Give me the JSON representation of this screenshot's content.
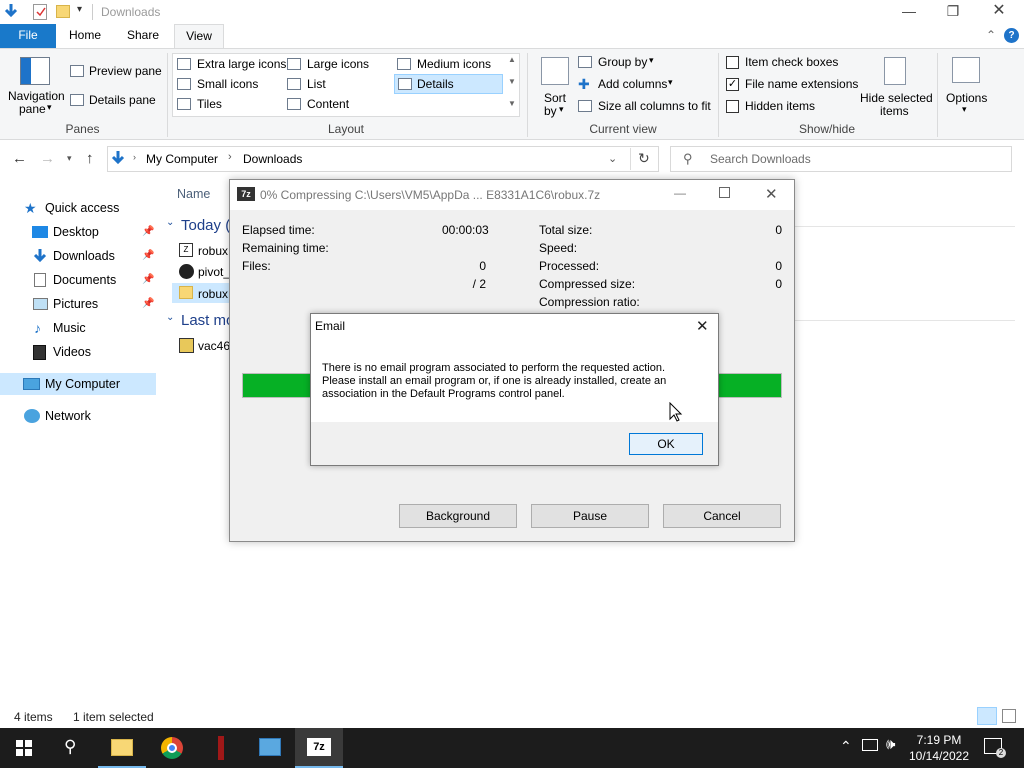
{
  "window": {
    "title": "Downloads"
  },
  "tabs": {
    "file": "File",
    "home": "Home",
    "share": "Share",
    "view": "View"
  },
  "ribbon": {
    "panes": {
      "navigation_pane": "Navigation",
      "navigation_pane2": "pane",
      "preview_pane": "Preview pane",
      "details_pane": "Details pane",
      "group": "Panes"
    },
    "layout": {
      "extra_large": "Extra large icons",
      "large": "Large icons",
      "medium": "Medium icons",
      "small": "Small icons",
      "list": "List",
      "details": "Details",
      "tiles": "Tiles",
      "content": "Content",
      "group": "Layout"
    },
    "current_view": {
      "sort_by": "Sort",
      "sort_by2": "by",
      "group_by": "Group by",
      "add_columns": "Add columns",
      "size_columns": "Size all columns to fit",
      "group": "Current view"
    },
    "show_hide": {
      "item_check_boxes": "Item check boxes",
      "file_name_extensions": "File name extensions",
      "hidden_items": "Hidden items",
      "hide_selected": "Hide selected",
      "hide_selected2": "items",
      "options": "Options",
      "group": "Show/hide"
    }
  },
  "address": {
    "root": "My Computer",
    "folder": "Downloads",
    "search_placeholder": "Search Downloads"
  },
  "nav": {
    "quick_access": "Quick access",
    "desktop": "Desktop",
    "downloads": "Downloads",
    "documents": "Documents",
    "pictures": "Pictures",
    "music": "Music",
    "videos": "Videos",
    "my_computer": "My Computer",
    "network": "Network"
  },
  "files": {
    "name_col": "Name",
    "today": "Today (",
    "f1": "robux",
    "f2": "pivot_",
    "f3": "robux",
    "last_mod": "Last mo",
    "f4": "vac46"
  },
  "status": {
    "items": "4 items",
    "selected": "1 item selected"
  },
  "zip": {
    "title": "0% Compressing C:\\Users\\VM5\\AppDa ... E8331A1C6\\robux.7z",
    "elapsed_label": "Elapsed time:",
    "elapsed": "00:00:03",
    "remaining_label": "Remaining time:",
    "files_label": "Files:",
    "files": "0",
    "files_total": "/ 2",
    "total_size_label": "Total size:",
    "total_size": "0",
    "speed_label": "Speed:",
    "processed_label": "Processed:",
    "processed": "0",
    "compressed_label": "Compressed size:",
    "compressed": "0",
    "ratio_label": "Compression ratio:",
    "progress": 1.0,
    "background": "Background",
    "pause": "Pause",
    "cancel": "Cancel"
  },
  "email": {
    "title": "Email",
    "line1": "There is no email program associated to perform the requested action.",
    "line2": "Please install an email program or, if one is already installed, create an",
    "line3": "association in the Default Programs control panel.",
    "ok": "OK"
  },
  "taskbar": {
    "time": "7:19 PM",
    "date": "10/14/2022"
  },
  "colors": {
    "accent": "#1979ca",
    "progress": "#06b025"
  }
}
